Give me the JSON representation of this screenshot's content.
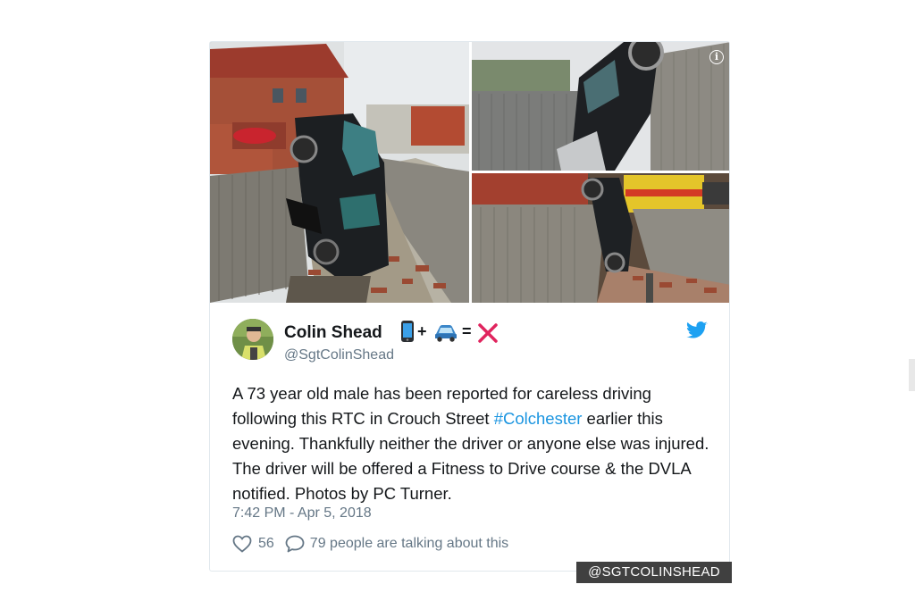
{
  "tweet": {
    "author_name": "Colin Shead",
    "handle": "@SgtColinShead",
    "text_before": "A 73 year old male has been reported for careless driving following this RTC in Crouch Street ",
    "hashtag": "#Colchester",
    "text_after": " earlier this evening. Thankfully neither the driver or anyone else was injured. The driver will be offered a Fitness to Drive course & the DVLA notified. Photos by PC Turner.",
    "timestamp": "7:42 PM - Apr 5, 2018",
    "likes": "56",
    "talking": "79 people are talking about this",
    "emoji_plus": "+",
    "emoji_equals": "="
  },
  "media": {
    "info_glyph": "i"
  },
  "watermark": "@SGTCOLINSHEAD",
  "colors": {
    "link": "#1b95e0",
    "twitter_blue": "#1da1f2",
    "muted": "#657786",
    "cross": "#e0245e"
  },
  "icons": [
    "info-icon",
    "twitter-bird-icon",
    "heart-icon",
    "reply-icon",
    "phone-emoji",
    "car-emoji",
    "cross-emoji"
  ]
}
